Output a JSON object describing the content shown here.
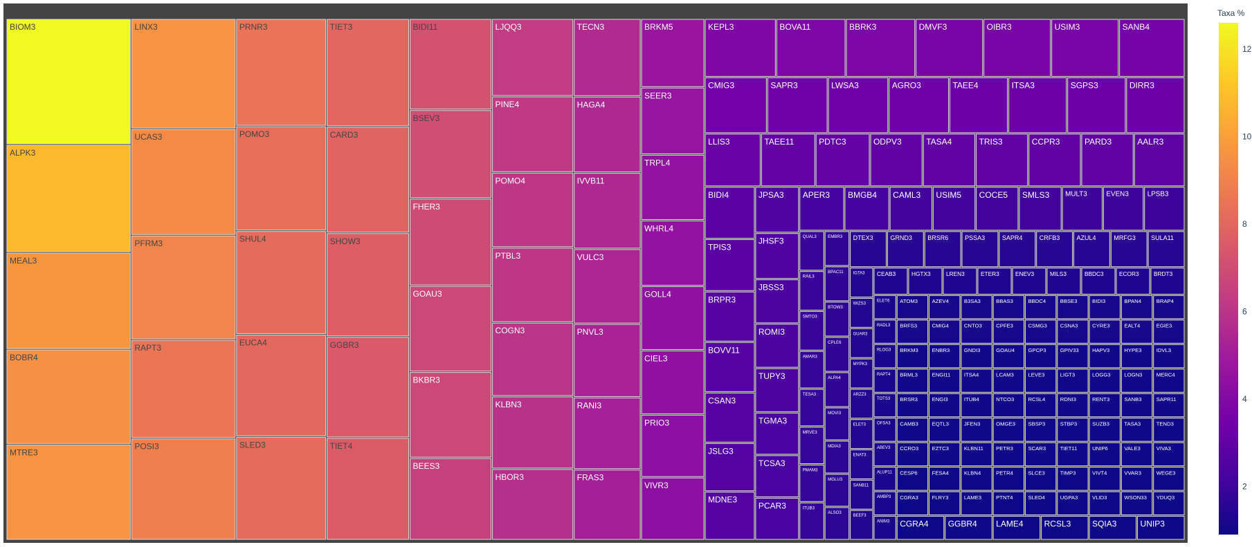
{
  "chart_data": {
    "type": "treemap",
    "colorbar": {
      "title": "Taxa %",
      "min": 0.9,
      "max": 12.6,
      "ticks": [
        2,
        4,
        6,
        8,
        10,
        12
      ],
      "colorscale": [
        "#0d0887",
        "#46039f",
        "#7201a8",
        "#9c179e",
        "#bd3786",
        "#d8576b",
        "#ed7953",
        "#fb9f3a",
        "#fdca26",
        "#f0f921"
      ]
    },
    "columns": [
      {
        "w": 1.0,
        "items": [
          [
            "BIOM3",
            12.6
          ],
          [
            "ALPK3",
            10.8
          ],
          [
            "MEAL3",
            9.7
          ],
          [
            "BOBR4",
            9.5
          ],
          [
            "MTRE3",
            9.6
          ]
        ]
      },
      {
        "w": 0.84,
        "items": [
          [
            "LINX3",
            9.6
          ],
          [
            "UCAS3",
            9.3
          ],
          [
            "PFRM3",
            9.1
          ],
          [
            "RAPT3",
            8.6
          ],
          [
            "POSI3",
            8.9
          ]
        ]
      },
      {
        "w": 0.725,
        "items": [
          [
            "PRNR3",
            8.5
          ],
          [
            "POMO3",
            8.3
          ],
          [
            "SHUL4",
            8.2
          ],
          [
            "EUCA4",
            8.1
          ],
          [
            "SLED3",
            8.2
          ]
        ]
      },
      {
        "w": 0.665,
        "items": [
          [
            "TIET3",
            8.0
          ],
          [
            "CARD3",
            7.9
          ],
          [
            "SHOW3",
            7.7
          ],
          [
            "GGBR3",
            7.5
          ],
          [
            "TIET4",
            7.6
          ]
        ]
      },
      {
        "w": 0.66,
        "items": [
          [
            "BIDI11",
            7.2
          ],
          [
            "BSEV3",
            7.0
          ],
          [
            "FHER3",
            6.9
          ],
          [
            "GOAU3",
            6.8
          ],
          [
            "BKBR3",
            6.8
          ],
          [
            "BEES3",
            6.5
          ]
        ]
      },
      {
        "w": 0.655,
        "items": [
          [
            "LJQQ3",
            6.3
          ],
          [
            "PINE4",
            6.2
          ],
          [
            "POMO4",
            6.1
          ],
          [
            "PTBL3",
            6.1
          ],
          [
            "COGN3",
            6.0
          ],
          [
            "KLBN3",
            5.9
          ],
          [
            "HBOR3",
            5.8
          ]
        ]
      },
      {
        "w": 0.54,
        "items": [
          [
            "TECN3",
            5.6
          ],
          [
            "HAGA4",
            5.5
          ],
          [
            "IVVB11",
            5.5
          ],
          [
            "VULC3",
            5.4
          ],
          [
            "PNVL3",
            5.3
          ],
          [
            "RANI3",
            5.2
          ],
          [
            "FRAS3",
            5.1
          ]
        ]
      },
      {
        "w": 0.51,
        "items": [
          [
            "BRKM5",
            4.7
          ],
          [
            "SEER3",
            4.6
          ],
          [
            "TRPL4",
            4.5
          ],
          [
            "WHRL4",
            4.5
          ],
          [
            "GOLL4",
            4.4
          ],
          [
            "CIEL3",
            4.4
          ],
          [
            "PRIO3",
            4.3
          ],
          [
            "VIVR3",
            4.3
          ]
        ]
      }
    ],
    "rows": [
      {
        "h": 0.112,
        "items": [
          [
            "KEPL3",
            3.9
          ],
          [
            "BOVA11",
            3.8
          ],
          [
            "BBRK3",
            3.8
          ],
          [
            "DMVF3",
            3.7
          ],
          [
            "OIBR3",
            3.7
          ],
          [
            "USIM3",
            3.7
          ],
          [
            "SANB4",
            3.6
          ]
        ]
      },
      {
        "h": 0.108,
        "items": [
          [
            "CMIG3",
            3.5
          ],
          [
            "SAPR3",
            3.4
          ],
          [
            "LWSA3",
            3.4
          ],
          [
            "AGRO3",
            3.4
          ],
          [
            "TAEE4",
            3.3
          ],
          [
            "ITSA3",
            3.3
          ],
          [
            "SGPS3",
            3.3
          ],
          [
            "DIRR3",
            3.3
          ]
        ]
      },
      {
        "h": 0.102,
        "items": [
          [
            "LLIS3",
            3.2
          ],
          [
            "TAEE11",
            3.1
          ],
          [
            "PDTC3",
            3.1
          ],
          [
            "ODPV3",
            3.0
          ],
          [
            "TASA4",
            3.0
          ],
          [
            "TRIS3",
            3.0
          ],
          [
            "CCPR3",
            3.0
          ],
          [
            "PARD3",
            3.0
          ],
          [
            "AALR3",
            2.9
          ]
        ]
      }
    ],
    "region_columns": [
      {
        "w": 0.105,
        "items": [
          [
            "BIDI4",
            2.8
          ],
          [
            "TPIS3",
            2.8
          ],
          [
            "BRPR3",
            2.7
          ],
          [
            "BOVV11",
            2.7
          ],
          [
            "CSAN3",
            2.7
          ],
          [
            "JSLG3",
            2.6
          ],
          [
            "MDNE3",
            2.6
          ]
        ]
      },
      {
        "w": 0.092,
        "items": [
          [
            "JPSA3",
            2.5
          ],
          [
            "JHSF3",
            2.5
          ],
          [
            "JBSS3",
            2.4
          ],
          [
            "ROMI3",
            2.4
          ],
          [
            "TUPY3",
            2.4
          ],
          [
            "TGMA3",
            2.3
          ],
          [
            "TCSA3",
            2.3
          ],
          [
            "PCAR3",
            2.3
          ]
        ]
      }
    ],
    "row_band": {
      "h": 0.085,
      "items": [
        [
          "APER3",
          2.2
        ],
        [
          "BMGB4",
          2.2
        ],
        [
          "CAML3",
          2.1
        ],
        [
          "USIM5",
          2.1
        ],
        [
          "COCE5",
          2.1
        ],
        [
          "SMLS3",
          2.1
        ],
        [
          "MULT3",
          2.0
        ],
        [
          "EVEN3",
          2.0
        ],
        [
          "LPSB3",
          2.0
        ]
      ]
    },
    "sub_columns": [
      {
        "w": 0.105,
        "items": [
          [
            "QUAL3",
            1.9
          ],
          [
            "RAIL3",
            1.9
          ],
          [
            "SMTO3",
            1.9
          ],
          [
            "AMAR3",
            1.8
          ],
          [
            "TESA3",
            1.8
          ],
          [
            "MRVE3",
            1.8
          ],
          [
            "PMAM3",
            1.8
          ],
          [
            "ITUB3",
            1.8
          ]
        ]
      },
      {
        "w": 0.105,
        "items": [
          [
            "EMBR3",
            1.7
          ],
          [
            "BPAC11",
            1.7
          ],
          [
            "BTOW3",
            1.7
          ],
          [
            "CPLE6",
            1.7
          ],
          [
            "ALPA4",
            1.7
          ],
          [
            "MOVI3",
            1.6
          ],
          [
            "MDIA3",
            1.6
          ],
          [
            "MGLU3",
            1.6
          ],
          [
            "ALSO3",
            1.6
          ]
        ]
      }
    ],
    "row_band2": {
      "h": 0.07,
      "items": [
        [
          "DTEX3",
          1.5
        ],
        [
          "GRND3",
          1.5
        ],
        [
          "BRSR6",
          1.5
        ],
        [
          "PSSA3",
          1.5
        ],
        [
          "SAPR4",
          1.5
        ],
        [
          "CRFB3",
          1.5
        ],
        [
          "AZUL4",
          1.5
        ],
        [
          "MRFG3",
          1.5
        ],
        [
          "SULA11",
          1.5
        ]
      ]
    },
    "sub_columns2": [
      {
        "w": 0.11,
        "items": [
          [
            "IGTA3",
            1.4
          ],
          [
            "WIZS3",
            1.4
          ],
          [
            "GUAR3",
            1.4
          ],
          [
            "MYPK3",
            1.4
          ],
          [
            "ARZZ3",
            1.4
          ],
          [
            "ELET3",
            1.4
          ],
          [
            "ENAT3",
            1.4
          ],
          [
            "SANB11",
            1.4
          ],
          [
            "BEEF3",
            1.4
          ]
        ]
      }
    ],
    "row_band3": {
      "h": 0.085,
      "items": [
        [
          "CEAB3",
          1.3
        ],
        [
          "HGTX3",
          1.3
        ],
        [
          "LREN3",
          1.3
        ],
        [
          "ETER3",
          1.3
        ],
        [
          "ENEV3",
          1.3
        ],
        [
          "MILS3",
          1.3
        ],
        [
          "BBDC3",
          1.3
        ],
        [
          "ECOR3",
          1.3
        ],
        [
          "BRDT3",
          1.3
        ]
      ]
    },
    "sub_columns3": [
      {
        "w": 0.12,
        "items": [
          [
            "ELET6",
            1.2
          ],
          [
            "RADL3",
            1.2
          ],
          [
            "RLOG3",
            1.2
          ],
          [
            "RAPT4",
            1.2
          ],
          [
            "TOTS3",
            1.2
          ],
          [
            "OFSA3",
            1.2
          ],
          [
            "ABEV3",
            1.2
          ],
          [
            "ALUP11",
            1.2
          ],
          [
            "AMBP3",
            1.2
          ],
          [
            "ANIM3",
            1.2
          ]
        ]
      }
    ],
    "grid": {
      "cols": 9,
      "items": [
        [
          "ATOM3",
          1.1
        ],
        [
          "AZEV4",
          1.1
        ],
        [
          "B3SA3",
          1.1
        ],
        [
          "BBAS3",
          1.1
        ],
        [
          "BBDC4",
          1.1
        ],
        [
          "BBSE3",
          1.1
        ],
        [
          "BIDI3",
          1.1
        ],
        [
          "BPAN4",
          1.1
        ],
        [
          "BRAP4",
          1.1
        ],
        [
          "BRFS3",
          1.1
        ],
        [
          "CMIG4",
          1.1
        ],
        [
          "CNTO3",
          1.1
        ],
        [
          "CPFE3",
          1.1
        ],
        [
          "CSMG3",
          1.1
        ],
        [
          "CSNA3",
          1.1
        ],
        [
          "CYRE3",
          1.1
        ],
        [
          "EALT4",
          1.1
        ],
        [
          "EGIE3",
          1.1
        ],
        [
          "BRKM3",
          1.0
        ],
        [
          "ENBR3",
          1.0
        ],
        [
          "GNDI3",
          1.0
        ],
        [
          "GOAU4",
          1.0
        ],
        [
          "GPCP3",
          1.0
        ],
        [
          "GPIV33",
          1.0
        ],
        [
          "HAPV3",
          1.0
        ],
        [
          "HYPE3",
          1.0
        ],
        [
          "IDVL3",
          1.0
        ],
        [
          "BRML3",
          1.0
        ],
        [
          "ENGI11",
          1.0
        ],
        [
          "ITSA4",
          1.0
        ],
        [
          "LCAM3",
          1.0
        ],
        [
          "LEVE3",
          1.0
        ],
        [
          "LIGT3",
          1.0
        ],
        [
          "LOGG3",
          1.0
        ],
        [
          "LOGN3",
          1.0
        ],
        [
          "MERC4",
          1.0
        ],
        [
          "BRSR3",
          1.0
        ],
        [
          "ENGI3",
          1.0
        ],
        [
          "ITUB4",
          1.0
        ],
        [
          "NTCO3",
          1.0
        ],
        [
          "RCSL4",
          1.0
        ],
        [
          "RDNI3",
          1.0
        ],
        [
          "RENT3",
          1.0
        ],
        [
          "SANB3",
          1.0
        ],
        [
          "SAPR11",
          1.0
        ],
        [
          "CAMB3",
          0.95
        ],
        [
          "EQTL3",
          0.95
        ],
        [
          "JFEN3",
          0.95
        ],
        [
          "OMGE3",
          0.95
        ],
        [
          "SBSP3",
          0.95
        ],
        [
          "STBP3",
          0.95
        ],
        [
          "SUZB3",
          0.95
        ],
        [
          "TASA3",
          0.95
        ],
        [
          "TEND3",
          0.95
        ],
        [
          "CCRO3",
          0.95
        ],
        [
          "EZTC3",
          0.95
        ],
        [
          "KLBN11",
          0.95
        ],
        [
          "PETR3",
          0.95
        ],
        [
          "SCAR3",
          0.95
        ],
        [
          "TIET11",
          0.95
        ],
        [
          "UNIP6",
          0.95
        ],
        [
          "VALE3",
          0.95
        ],
        [
          "VIVA3",
          0.95
        ],
        [
          "CESP6",
          0.9
        ],
        [
          "FESA4",
          0.9
        ],
        [
          "KLBN4",
          0.9
        ],
        [
          "PETR4",
          0.9
        ],
        [
          "SLCE3",
          0.9
        ],
        [
          "TIMP3",
          0.9
        ],
        [
          "VIVT4",
          0.9
        ],
        [
          "VVAR3",
          0.9
        ],
        [
          "WEGE3",
          0.9
        ],
        [
          "CGRA3",
          0.9
        ],
        [
          "FLRY3",
          0.9
        ],
        [
          "LAME3",
          0.9
        ],
        [
          "PTNT4",
          0.9
        ],
        [
          "SLED4",
          0.9
        ],
        [
          "UGPA3",
          0.9
        ],
        [
          "VLID3",
          0.9
        ],
        [
          "WSON33",
          0.9
        ],
        [
          "YDUQ3",
          0.9
        ],
        [
          "CGRA4",
          0.9
        ],
        [
          "GGBR4",
          0.9
        ],
        [
          "LAME4",
          0.9
        ],
        [
          "RCSL3",
          0.9
        ],
        [
          "SQIA3",
          0.9
        ],
        [
          "UNIP3",
          0.9
        ]
      ]
    }
  }
}
